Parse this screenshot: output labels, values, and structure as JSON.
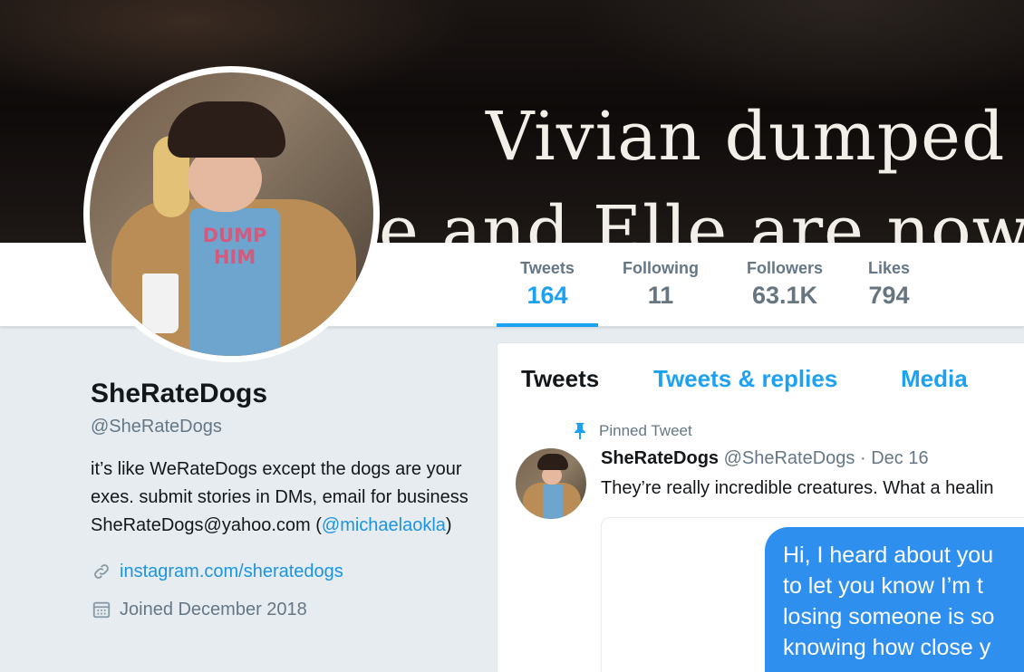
{
  "banner": {
    "line1": "Vivian dumped",
    "line2": "e and Elle are now"
  },
  "avatar": {
    "shirt_text": "DUMP HIM"
  },
  "stats": [
    {
      "label": "Tweets",
      "value": "164",
      "active": true
    },
    {
      "label": "Following",
      "value": "11",
      "active": false
    },
    {
      "label": "Followers",
      "value": "63.1K",
      "active": false
    },
    {
      "label": "Likes",
      "value": "794",
      "active": false
    }
  ],
  "profile": {
    "name": "SheRateDogs",
    "handle": "@SheRateDogs",
    "bio_text": "it’s like WeRateDogs except the dogs are your exes. submit stories in DMs, email for business SheRateDogs@yahoo.com",
    "bio_paren_open": "(",
    "bio_mention": "@michaelaokla",
    "bio_paren_close": ")",
    "website": "instagram.com/sheratedogs",
    "joined": "Joined December 2018"
  },
  "tabs": [
    {
      "label": "Tweets",
      "active": true
    },
    {
      "label": "Tweets & replies",
      "active": false
    },
    {
      "label": "Media",
      "active": false
    }
  ],
  "pinned_tweet": {
    "pinned_label": "Pinned Tweet",
    "author_name": "SheRateDogs",
    "author_handle": "@SheRateDogs",
    "separator": " · ",
    "date": "Dec 16",
    "text": "They’re really incredible creatures. What a healin",
    "bubble_lines": [
      "Hi, I heard about you",
      "to let you know I’m t",
      "losing someone is so",
      "knowing how close y"
    ]
  },
  "colors": {
    "accent": "#1da1f2",
    "link": "#1b95e0",
    "muted": "#657786",
    "imessage_blue": "#2e8fef"
  },
  "icons": {
    "link": "link-icon",
    "calendar": "calendar-icon",
    "pin": "pin-icon"
  }
}
